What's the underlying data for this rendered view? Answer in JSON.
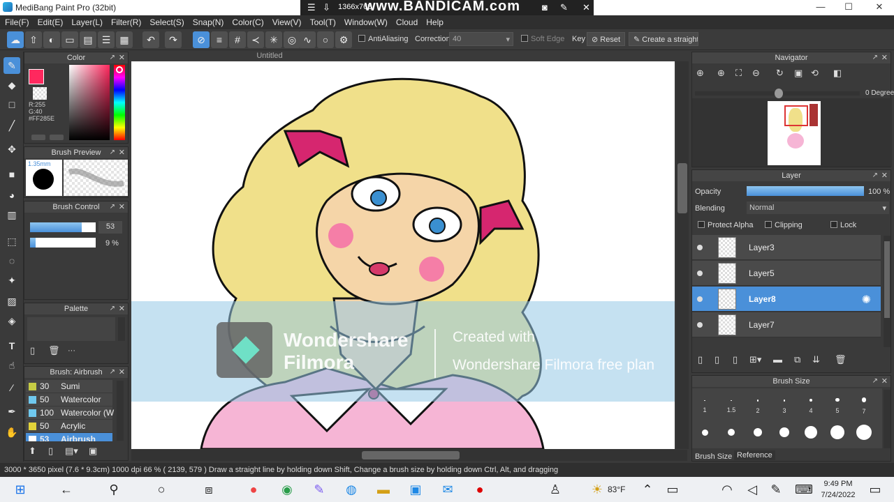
{
  "window": {
    "title": "MediBang Paint Pro (32bit)",
    "minimize": "—",
    "maximize": "☐",
    "close": "✕"
  },
  "recorder": {
    "resolution": "1366x768",
    "brand": "www.BANDICAM.com"
  },
  "menu": [
    "File(F)",
    "Edit(E)",
    "Layer(L)",
    "Filter(R)",
    "Select(S)",
    "Snap(N)",
    "Color(C)",
    "View(V)",
    "Tool(T)",
    "Window(W)",
    "Cloud",
    "Help"
  ],
  "toolbar": {
    "antialiasing": "AntiAliasing",
    "correction_label": "Correction",
    "correction_value": "40",
    "soft_edge": "Soft Edge",
    "key": "Key",
    "reset": "Reset",
    "create_straight": "Create a straight"
  },
  "color_panel": {
    "title": "Color",
    "r": "R:255",
    "g": "G:40",
    "hex": "#FF285E",
    "primary": "#FF285E"
  },
  "brush_preview": {
    "title": "Brush Preview",
    "size": "1.35mm"
  },
  "brush_control": {
    "title": "Brush Control",
    "size": "53",
    "opacity": "9 %",
    "size_fill": 0.79,
    "opacity_fill": 0.09
  },
  "palette": {
    "title": "Palette",
    "dots": "···"
  },
  "brush_list": {
    "title": "Brush: Airbrush",
    "items": [
      {
        "size": "30",
        "name": "Sumi",
        "color": "#c6cc44"
      },
      {
        "size": "50",
        "name": "Watercolor",
        "color": "#6fc8ee"
      },
      {
        "size": "100",
        "name": "Watercolor (W",
        "color": "#6fc8ee"
      },
      {
        "size": "50",
        "name": "Acrylic",
        "color": "#e3d43a"
      },
      {
        "size": "53",
        "name": "Airbrush",
        "color": "#ffffff"
      }
    ]
  },
  "document": {
    "tab": "Untitled"
  },
  "watermark": {
    "line1": "Wondershare",
    "line2": "Filmora",
    "created": "Created with",
    "plan": "Wondershare Filmora free plan"
  },
  "navigator": {
    "title": "Navigator",
    "angle": "0 Degree"
  },
  "layer_panel": {
    "title": "Layer",
    "opacity_label": "Opacity",
    "opacity_value": "100 %",
    "blending_label": "Blending",
    "blending_value": "Normal",
    "protect_alpha": "Protect Alpha",
    "clipping": "Clipping",
    "lock": "Lock",
    "layers": [
      {
        "name": "Layer3"
      },
      {
        "name": "Layer5"
      },
      {
        "name": "Layer8"
      },
      {
        "name": "Layer7"
      }
    ]
  },
  "brush_size": {
    "title": "Brush Size",
    "labels": [
      "1",
      "1.5",
      "2",
      "3",
      "4",
      "5",
      "7"
    ],
    "tab_size": "Brush Size",
    "tab_reference": "Reference"
  },
  "status": {
    "text": "3000 * 3650 pixel  (7.6 * 9.3cm)  1000 dpi  66 %  ( 2139, 579 )  Draw a straight line by holding down Shift, Change a brush size by holding down Ctrl, Alt, and dragging"
  },
  "taskbar": {
    "weather": "83°F",
    "time": "9:49 PM",
    "date": "7/24/2022"
  }
}
